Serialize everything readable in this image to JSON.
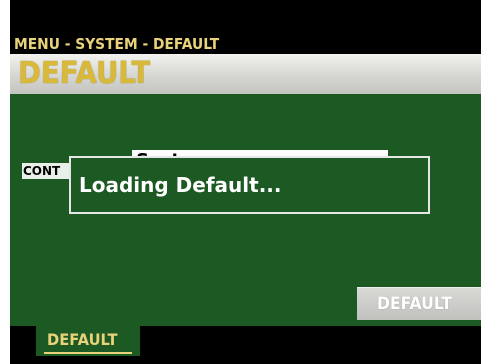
{
  "header": {
    "breadcrumb": "MENU - SYSTEM - DEFAULT",
    "title": "DEFAULT"
  },
  "main": {
    "param_label": "CONT",
    "param_value": "System"
  },
  "dialog": {
    "message": "Loading Default..."
  },
  "function_button": {
    "label": "DEFAULT"
  },
  "bottom_tabs": [
    {
      "label": "DEFAULT",
      "active": true
    }
  ],
  "colors": {
    "screen_green": "#1d5a23",
    "label_yellow": "#e8d27a",
    "title_gold": "#d8b93a",
    "bar_black": "#000000",
    "dialog_border": "#e6e6e6"
  }
}
